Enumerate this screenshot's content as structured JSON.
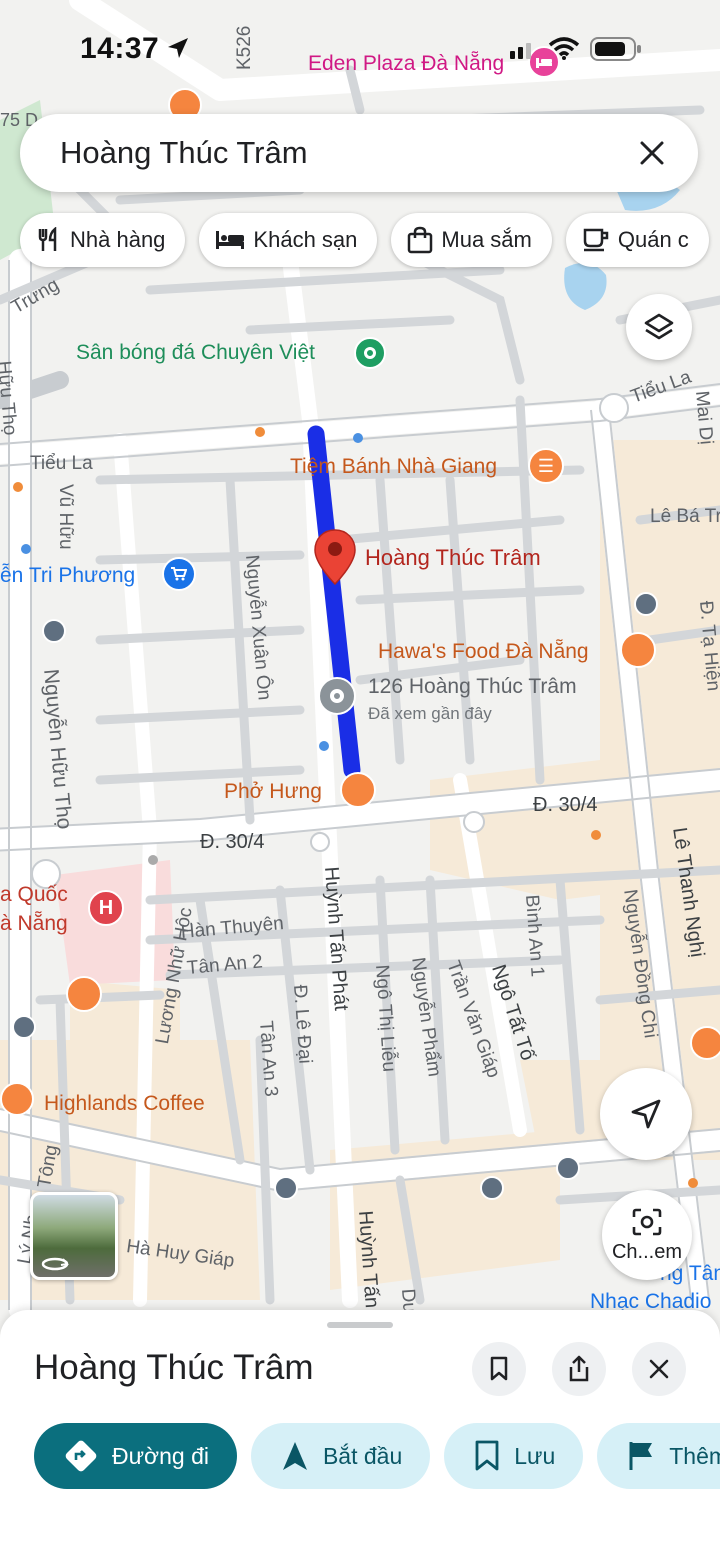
{
  "status_bar": {
    "time": "14:37"
  },
  "search": {
    "query": "Hoàng Thúc Trâm"
  },
  "chips": [
    {
      "label": "Nhà hàng",
      "icon": "fork-knife-icon"
    },
    {
      "label": "Khách sạn",
      "icon": "bed-icon"
    },
    {
      "label": "Mua sắm",
      "icon": "shopping-bag-icon"
    },
    {
      "label": "Quán c",
      "icon": "coffee-cup-icon"
    }
  ],
  "map": {
    "streets": [
      "K526",
      "75 D",
      "Trưng",
      "Tiểu La",
      "Tiểu La",
      "Vũ Hữu",
      "Nguyễn Xuân Ôn",
      "Nguyễn Hữu Thọ",
      "Hữu Thọ",
      "Đ. 30/4",
      "Đ. 30/4",
      "Huỳnh Tấn Phát",
      "Huỳnh Tấn",
      "Lương Nhữ Hộc",
      "Hàn Thuyên",
      "Tân An 2",
      "Tân An 3",
      "Đ. Lê Đại",
      "Ngô Thị Liễu",
      "Nguyễn Phẩm",
      "Trần Văn Giáp",
      "Ngô Tất Tố",
      "Bình An 1",
      "Nguyễn Đồng Chi",
      "Lê Thanh Nghị",
      "Lê Bá Tr",
      "Đ. Tạ Hiện",
      "Mai Dị",
      "Lý Nh",
      "Tông",
      "Hà Huy Giáp",
      "Dư"
    ],
    "pois": {
      "eden": "Eden Plaza Đà Nẵng",
      "stadium": "Sân bóng đá Chuyên Việt",
      "bakery": "Tiệm Bánh Nhà Giang",
      "selected": "Hoàng Thúc Trâm",
      "phuong": "ễn Tri Phương",
      "hawa": "Hawa's Food Đà Nẵng",
      "address": "126 Hoàng Thúc Trâm",
      "address_sub": "Đã xem gần đây",
      "pho": "Phở Hưng",
      "hospital_1": "a Quốc",
      "hospital_2": "à Nẵng",
      "highlands": "Highlands Coffee",
      "tam": "ng Tâm",
      "nhac": "Nhạc Chadio"
    }
  },
  "lens_label": "Ch...em",
  "sheet": {
    "title": "Hoàng Thúc Trâm",
    "actions": [
      {
        "label": "Đường đi",
        "icon": "directions-icon"
      },
      {
        "label": "Bắt đầu",
        "icon": "navigation-arrow-icon"
      },
      {
        "label": "Lưu",
        "icon": "bookmark-icon"
      },
      {
        "label": "Thêm",
        "icon": "flag-icon"
      }
    ]
  },
  "colors": {
    "route": "#1a2ee6",
    "pin": "#ea4335",
    "primary_action": "#0b6f7e",
    "secondary_action": "#d6f0f7"
  }
}
